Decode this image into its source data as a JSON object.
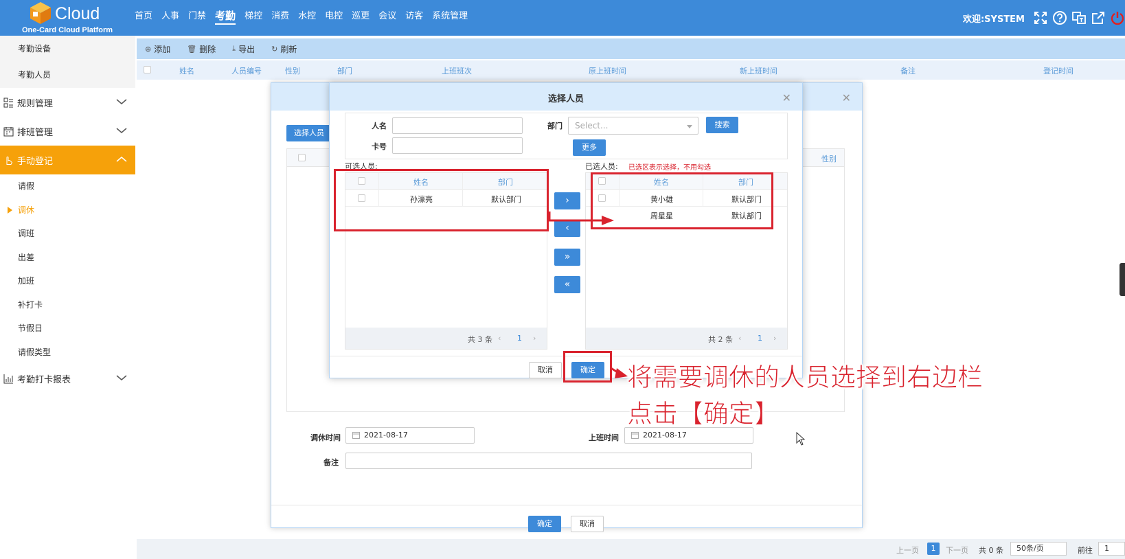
{
  "header": {
    "logo_text": "Cloud",
    "logo_sub": "One-Card Cloud Platform",
    "nav": [
      "首页",
      "人事",
      "门禁",
      "考勤",
      "梯控",
      "消费",
      "水控",
      "电控",
      "巡更",
      "会议",
      "访客",
      "系统管理"
    ],
    "active_nav": "考勤",
    "welcome": "欢迎:SYSTEM"
  },
  "sidebar": {
    "top_items": [
      "考勤设备",
      "考勤人员"
    ],
    "groups": [
      {
        "label": "规则管理",
        "icon": "rules-icon"
      },
      {
        "label": "排班管理",
        "icon": "schedule-icon"
      }
    ],
    "active_group": "手动登记",
    "sub_items": [
      "请假",
      "调休",
      "调班",
      "出差",
      "加班",
      "补打卡",
      "节假日",
      "请假类型"
    ],
    "active_item": "调休",
    "last_group": "考勤打卡报表"
  },
  "toolbar": {
    "add": "添加",
    "delete": "删除",
    "export": "导出",
    "refresh": "刷新"
  },
  "grid": {
    "columns": [
      "姓名",
      "人员编号",
      "性别",
      "部门",
      "上班班次",
      "原上班时间",
      "新上班时间",
      "备注",
      "登记时间"
    ]
  },
  "pager": {
    "prev": "上一页",
    "page": "1",
    "next": "下一页",
    "total": "共 0 条",
    "page_size": "50条/页",
    "goto": "前往",
    "goto_value": "1"
  },
  "outer_dialog": {
    "pick_button": "选择人员",
    "sex_column": "性别",
    "rest_time_label": "调休时间",
    "rest_time_value": "2021-08-17",
    "work_time_label": "上班时间",
    "work_time_value": "2021-08-17",
    "note_label": "备注",
    "confirm": "确定",
    "cancel": "取消"
  },
  "inner_dialog": {
    "title": "选择人员",
    "name_label": "人名",
    "card_label": "卡号",
    "dept_label": "部门",
    "dept_placeholder": "Select...",
    "search": "搜索",
    "more": "更多",
    "available_label": "可选人员:",
    "selected_label": "已选人员:",
    "selected_hint": "已选区表示选择，不用勾选",
    "col_name": "姓名",
    "col_dept": "部门",
    "available": [
      {
        "name": "孙濠亮",
        "dept": "默认部门"
      }
    ],
    "selected": [
      {
        "name": "黄小雄",
        "dept": "默认部门"
      },
      {
        "name": "周星星",
        "dept": "默认部门"
      }
    ],
    "available_total": "共 3 条",
    "selected_total": "共 2 条",
    "available_page": "1",
    "selected_page": "1",
    "move_right": "›",
    "move_left": "‹",
    "move_all_right": "»",
    "move_all_left": "«",
    "cancel": "取消",
    "confirm": "确定"
  },
  "annotation": {
    "line1": "将需要调休的人员选择到右边栏",
    "line2": "点击【确定】",
    "color": "#d9232e"
  }
}
